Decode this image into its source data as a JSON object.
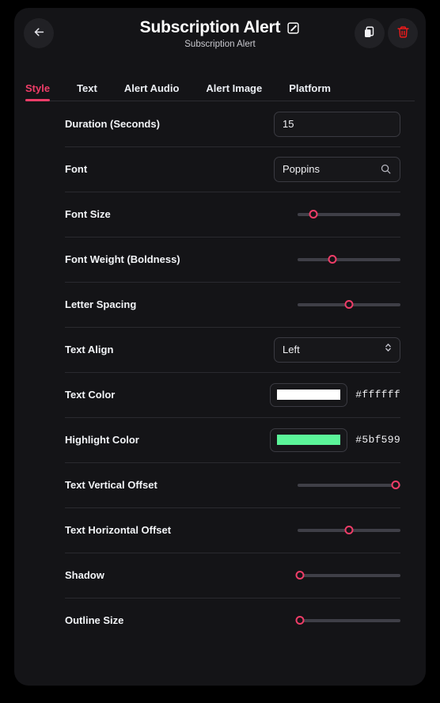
{
  "header": {
    "title": "Subscription Alert",
    "subtitle": "Subscription Alert",
    "back_icon": "arrow-left-icon",
    "edit_icon": "edit-pencil-icon",
    "duplicate_icon": "duplicate-icon",
    "delete_icon": "trash-icon"
  },
  "tabs": [
    {
      "label": "Style",
      "active": true
    },
    {
      "label": "Text",
      "active": false
    },
    {
      "label": "Alert Audio",
      "active": false
    },
    {
      "label": "Alert Image",
      "active": false
    },
    {
      "label": "Platform",
      "active": false
    }
  ],
  "rows": [
    {
      "label": "Duration (Seconds)",
      "type": "input",
      "value": "15",
      "placeholder": ""
    },
    {
      "label": "Font",
      "type": "search-input",
      "value": "Poppins",
      "placeholder": "",
      "icon": "search-icon"
    },
    {
      "label": "Font Size",
      "type": "slider",
      "percent": 15
    },
    {
      "label": "Font Weight (Boldness)",
      "type": "slider",
      "percent": 34
    },
    {
      "label": "Letter Spacing",
      "type": "slider",
      "percent": 50
    },
    {
      "label": "Text Align",
      "type": "select",
      "value": "Left",
      "icon": "chevron-updown-icon"
    },
    {
      "label": "Text Color",
      "type": "color",
      "value": "#ffffff",
      "swatch": "#ffffff"
    },
    {
      "label": "Highlight Color",
      "type": "color",
      "value": "#5bf599",
      "swatch": "#5bf599"
    },
    {
      "label": "Text Vertical Offset",
      "type": "slider",
      "percent": 95
    },
    {
      "label": "Text Horizontal Offset",
      "type": "slider",
      "percent": 50
    },
    {
      "label": "Shadow",
      "type": "slider",
      "percent": 2
    },
    {
      "label": "Outline Size",
      "type": "slider",
      "percent": 2
    }
  ],
  "colors": {
    "accent": "#ef3d68",
    "danger": "#ef1b1b",
    "card_bg": "#141417",
    "page_bg": "#000000",
    "highlight": "#5bf599"
  }
}
